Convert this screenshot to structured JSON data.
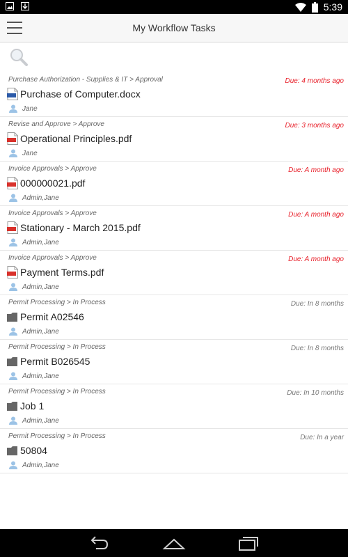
{
  "status": {
    "time": "5:39"
  },
  "header": {
    "title": "My Workflow Tasks"
  },
  "colors": {
    "overdue": "#e8202a",
    "normal": "#777777",
    "pdf": "#d9312b",
    "docx": "#2b5aa8",
    "folder": "#666666",
    "user": "#9cc3e6"
  },
  "tasks": [
    {
      "path": "Purchase Authorization - Supplies & IT > Approval",
      "due": "Due: 4 months ago",
      "name": "Purchase of Computer.docx",
      "assignee": "Jane",
      "icon": "docx-icon",
      "overdue": true
    },
    {
      "path": "Revise and Approve > Approve",
      "due": "Due: 3 months ago",
      "name": "Operational Principles.pdf",
      "assignee": "Jane",
      "icon": "pdf-icon",
      "overdue": true
    },
    {
      "path": "Invoice Approvals > Approve",
      "due": "Due: A month ago",
      "name": "000000021.pdf",
      "assignee": "Admin,Jane",
      "icon": "pdf-icon",
      "overdue": true
    },
    {
      "path": "Invoice Approvals > Approve",
      "due": "Due: A month ago",
      "name": "Stationary - March 2015.pdf",
      "assignee": "Admin,Jane",
      "icon": "pdf-icon",
      "overdue": true
    },
    {
      "path": "Invoice Approvals > Approve",
      "due": "Due: A month ago",
      "name": "Payment Terms.pdf",
      "assignee": "Admin,Jane",
      "icon": "pdf-icon",
      "overdue": true
    },
    {
      "path": "Permit Processing > In Process",
      "due": "Due: In 8 months",
      "name": "Permit A02546",
      "assignee": "Admin,Jane",
      "icon": "folder-icon",
      "overdue": false
    },
    {
      "path": "Permit Processing > In Process",
      "due": "Due: In 8 months",
      "name": "Permit B026545",
      "assignee": "Admin,Jane",
      "icon": "folder-icon",
      "overdue": false
    },
    {
      "path": "Permit Processing > In Process",
      "due": "Due: In 10 months",
      "name": "Job 1",
      "assignee": "Admin,Jane",
      "icon": "folder-icon",
      "overdue": false
    },
    {
      "path": "Permit Processing > In Process",
      "due": "Due: In a year",
      "name": "50804",
      "assignee": "Admin,Jane",
      "icon": "folder-icon",
      "overdue": false
    }
  ]
}
